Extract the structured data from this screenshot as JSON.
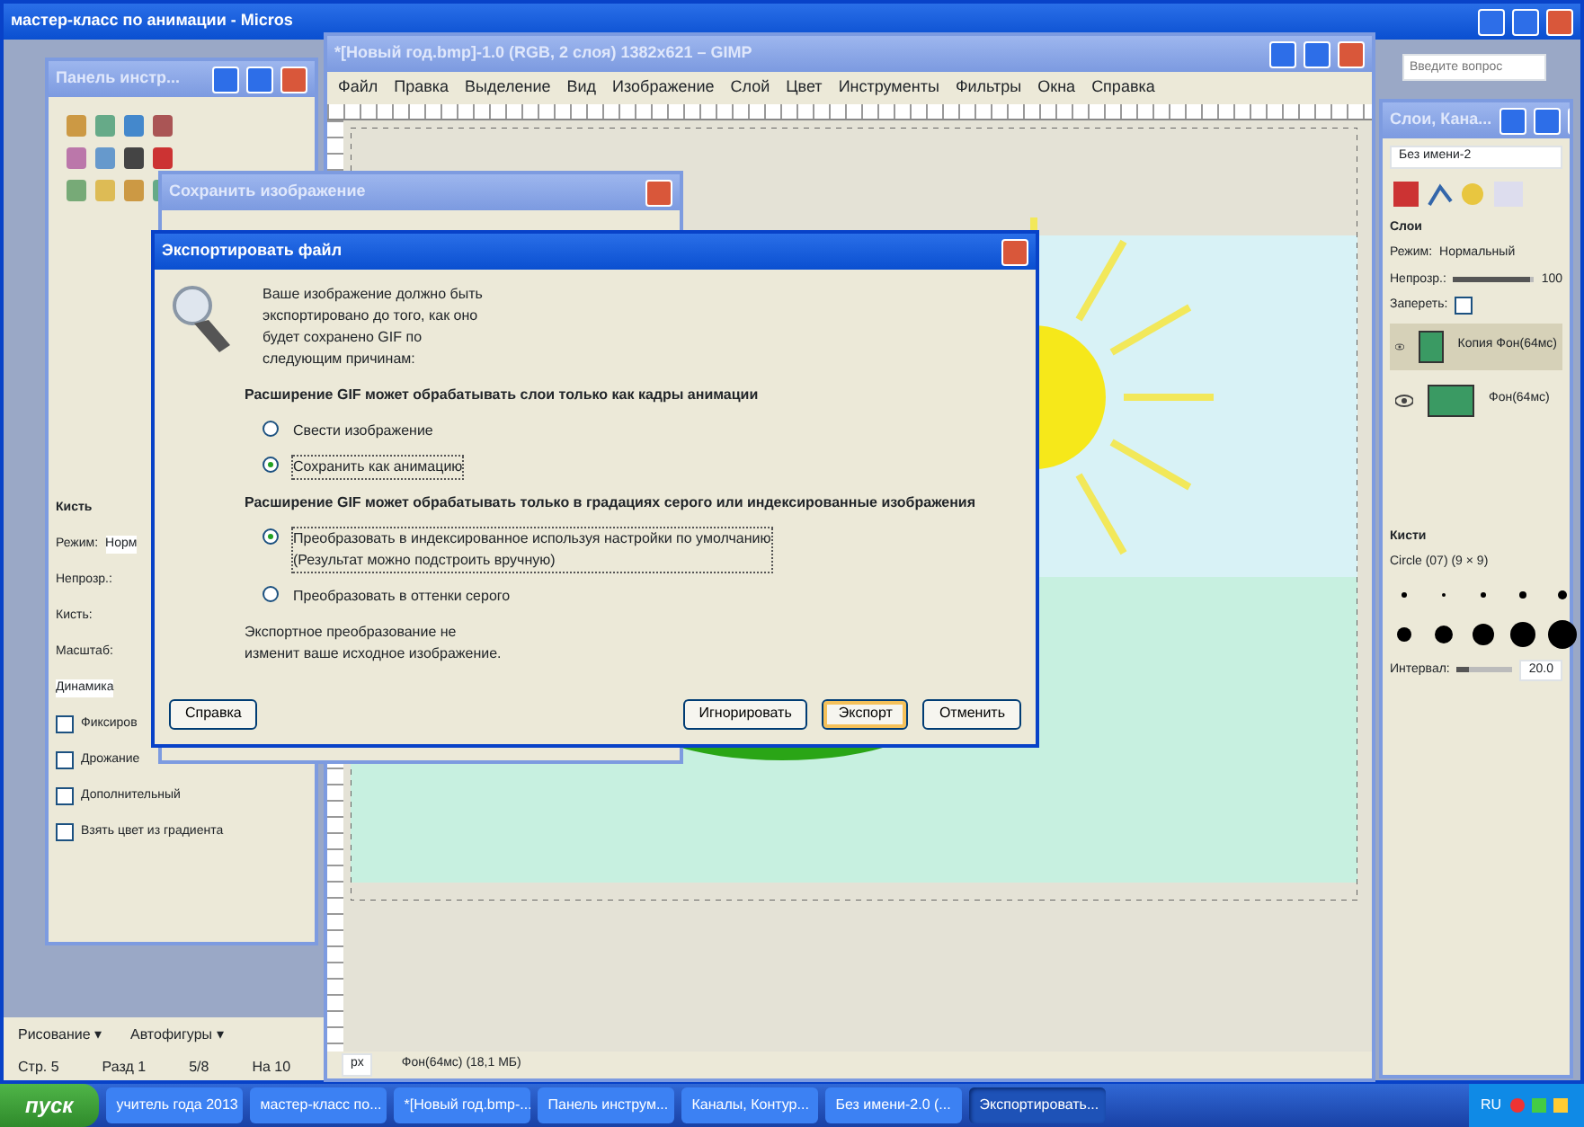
{
  "word_window": {
    "title": "мастер-класс по анимации - Micros",
    "drawing_toolbar": [
      "Рисование ▾",
      "Автофигуры ▾"
    ],
    "status_bar": [
      "Стр. 5",
      "Разд 1",
      "5/8",
      "На 10"
    ]
  },
  "ask_box": {
    "placeholder": "Введите вопрос"
  },
  "toolbox": {
    "title": "Панель инстр...",
    "options_title": "Кисть",
    "fields": [
      {
        "label": "Режим:",
        "value": "Норм"
      },
      {
        "label": "Непрозр.:"
      },
      {
        "label": "Кисть:"
      },
      {
        "label": "Масштаб:"
      }
    ],
    "dynamics": "Динамика",
    "checks": [
      {
        "label": "Фиксиров",
        "checked": false
      },
      {
        "label": "Дрожание",
        "checked": false
      },
      {
        "label": "Дополнительный",
        "checked": false
      },
      {
        "label": "Взять цвет из градиента",
        "checked": false
      }
    ]
  },
  "image_window": {
    "title": "*[Новый год.bmp]-1.0 (RGB, 2 слоя) 1382x621 – GIMP",
    "menu": [
      "Файл",
      "Правка",
      "Выделение",
      "Вид",
      "Изображение",
      "Слой",
      "Цвет",
      "Инструменты",
      "Фильтры",
      "Окна",
      "Справка"
    ],
    "status": {
      "unit": "px",
      "message": "Фон(64мс) (18,1 МБ)"
    }
  },
  "save_dialog": {
    "title": "Сохранить изображение"
  },
  "export_dialog": {
    "title": "Экспортировать файл",
    "intro": "Ваше изображение должно быть экспортировано до того, как оно будет сохранено GIF по следующим причинам:",
    "sections": [
      {
        "heading": "Расширение GIF может обрабатывать слои только как кадры анимации",
        "options": [
          {
            "label": "Свести изображение",
            "selected": false
          },
          {
            "label": "Сохранить как анимацию",
            "selected": true
          }
        ]
      },
      {
        "heading": "Расширение GIF может обрабатывать только в градациях серого или индексированные изображения",
        "options": [
          {
            "label": "Преобразовать в индексированное используя настройки по умолчанию",
            "note": "(Результат можно подстроить вручную)",
            "selected": true
          },
          {
            "label": "Преобразовать в оттенки серого",
            "selected": false
          }
        ]
      }
    ],
    "footer": "Экспортное преобразование не изменит ваше исходное изображение.",
    "buttons": [
      {
        "label": "Справка",
        "kind": "help"
      },
      {
        "label": "Игнорировать",
        "kind": "action"
      },
      {
        "label": "Экспорт",
        "kind": "default"
      },
      {
        "label": "Отменить",
        "kind": "action"
      }
    ]
  },
  "dock": {
    "title": "Слои, Кана...",
    "image": "Без имени-2",
    "layers_title": "Слои",
    "mode_label": "Режим:",
    "mode": "Нормальный",
    "opacity_label": "Непрозр.:",
    "opacity": {
      "level": 0.95,
      "reading": "100"
    },
    "lock_label": "Запереть:",
    "locked": false,
    "layers": [
      {
        "name": "Копия Фон(64мс)",
        "selected": true
      },
      {
        "name": "Фон(64мс)",
        "selected": false
      }
    ],
    "brushes_title": "Кисти",
    "brush_name": "Circle (07) (9 × 9)",
    "spacing_label": "Интервал:",
    "spacing": {
      "level": 0.2,
      "reading": "20.0"
    }
  },
  "taskbar": {
    "start": "пуск",
    "items": [
      {
        "label": "учитель года 2013",
        "selected": false
      },
      {
        "label": "мастер-класс по...",
        "selected": false
      },
      {
        "label": "*[Новый год.bmp-...",
        "selected": false
      },
      {
        "label": "Панель инструм...",
        "selected": false
      },
      {
        "label": "Каналы, Контур...",
        "selected": false
      },
      {
        "label": "Без имени-2.0 (...",
        "selected": false
      },
      {
        "label": "Экспортировать...",
        "selected": true
      }
    ],
    "lang": "RU"
  }
}
